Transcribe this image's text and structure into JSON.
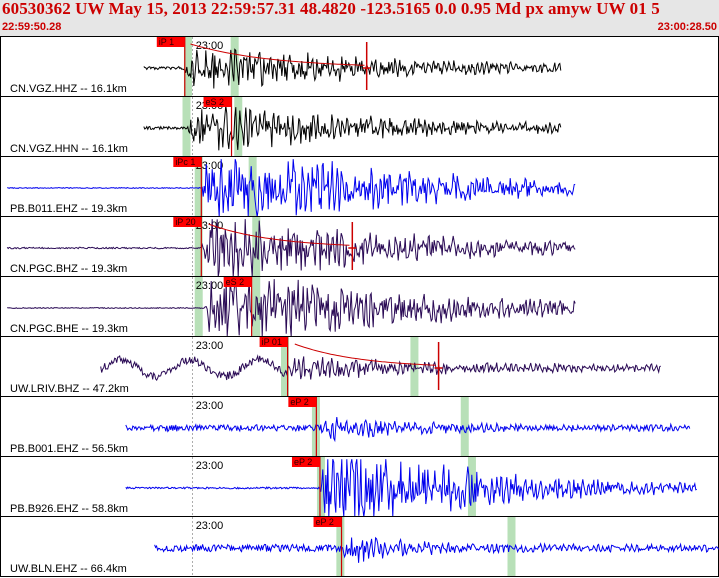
{
  "header": {
    "title": "60530362 UW May 15, 2013 22:59:57.31   48.4820 -123.5165  0.0 0.95 Md px amyw UW 01    5",
    "time_start": "22:59:50.28",
    "time_end": "23:00:28.50"
  },
  "colors": {
    "header_text": "#cc0000",
    "panel_border": "#000000",
    "pick_box": "#ff0000",
    "pick_line": "#cc0000",
    "sta_window": "#b8e0b8",
    "trace_black": "#000000",
    "trace_blue": "#0000ee",
    "trace_purple": "#2a0a55",
    "coda_fit": "#cc0000"
  },
  "traces": [
    {
      "label": "CN.VGZ.HHZ -- 16.1km",
      "minute": "23:00",
      "pick": "iP 1",
      "color": "black",
      "start": 0.2,
      "end": 0.78,
      "onset": 0.255,
      "amp": 0.2,
      "burst": 3.5,
      "decay": 0.55,
      "pick_x": 0.257,
      "s_x": 0.32,
      "green": [
        0.26,
        0.325
      ],
      "coda": true,
      "coda_end": 0.51
    },
    {
      "label": "CN.VGZ.HHN -- 16.1km",
      "minute": "23:00",
      "pick": "eS 2",
      "color": "black",
      "start": 0.2,
      "end": 0.78,
      "onset": 0.26,
      "amp": 0.2,
      "burst": 3.8,
      "decay": 0.5,
      "pick_x": 0.322,
      "s_x": 0.33,
      "green": [
        0.258,
        0.33
      ],
      "coda": false
    },
    {
      "label": "PB.B011.EHZ -- 19.3km",
      "minute": "23:00",
      "pick": "iPc 1",
      "color": "blue",
      "start": 0.01,
      "end": 0.8,
      "onset": 0.28,
      "amp": 0.06,
      "burst": 6,
      "decay": 0.6,
      "pick_x": 0.28,
      "s_x": 0.36,
      "green": [
        0.275,
        0.35
      ],
      "coda": false
    },
    {
      "label": "CN.PGC.BHZ -- 19.3km",
      "minute": "23:00",
      "pick": "iP 20",
      "color": "purple",
      "start": 0.01,
      "end": 0.8,
      "onset": 0.28,
      "amp": 0.1,
      "burst": 5,
      "decay": 0.55,
      "pick_x": 0.28,
      "s_x": 0.37,
      "green": [
        0.275,
        0.355
      ],
      "coda": true,
      "coda_end": 0.49
    },
    {
      "label": "CN.PGC.BHE -- 19.3km",
      "minute": "23:00",
      "pick": "eS 2",
      "color": "purple",
      "start": 0.01,
      "end": 0.8,
      "onset": 0.285,
      "amp": 0.06,
      "burst": 6,
      "decay": 0.55,
      "pick_x": 0.35,
      "s_x": 0.352,
      "green": [
        0.275,
        0.355
      ],
      "coda": false
    },
    {
      "label": "UW.LRIV.BHZ -- 47.2km",
      "minute": "23:00",
      "pick": "iP 01",
      "color": "purple",
      "start": 0.14,
      "end": 0.92,
      "onset": 0.4,
      "amp": 0.45,
      "burst": 1.8,
      "decay": 0.35,
      "pick_x": 0.4,
      "s_x": 0.57,
      "green": [
        0.395,
        0.575
      ],
      "coda": true,
      "coda_end": 0.61,
      "lowfreq": true
    },
    {
      "label": "PB.B001.EHZ -- 56.5km",
      "minute": "23:00",
      "pick": "eP 2",
      "color": "blue",
      "start": 0.175,
      "end": 0.96,
      "onset": 0.44,
      "amp": 0.45,
      "burst": 2.0,
      "decay": 0.2,
      "pick_x": 0.44,
      "s_x": 0.64,
      "green": [
        0.438,
        0.645
      ],
      "coda": false
    },
    {
      "label": "PB.B926.EHZ -- 58.8km",
      "minute": "23:00",
      "pick": "eP 2",
      "color": "blue",
      "start": 0.175,
      "end": 0.97,
      "onset": 0.445,
      "amp": 0.12,
      "burst": 7,
      "decay": 0.4,
      "pick_x": 0.445,
      "s_x": 0.655,
      "green": [
        0.445,
        0.655
      ],
      "coda": false
    },
    {
      "label": "UW.BLN.EHZ -- 66.4km",
      "minute": "23:00",
      "pick": "eP 2",
      "color": "blue",
      "start": 0.215,
      "end": 1.0,
      "onset": 0.475,
      "amp": 0.5,
      "burst": 2.4,
      "decay": 0.15,
      "pick_x": 0.475,
      "s_x": 0.705,
      "green": [
        0.472,
        0.71
      ],
      "coda": false
    }
  ]
}
